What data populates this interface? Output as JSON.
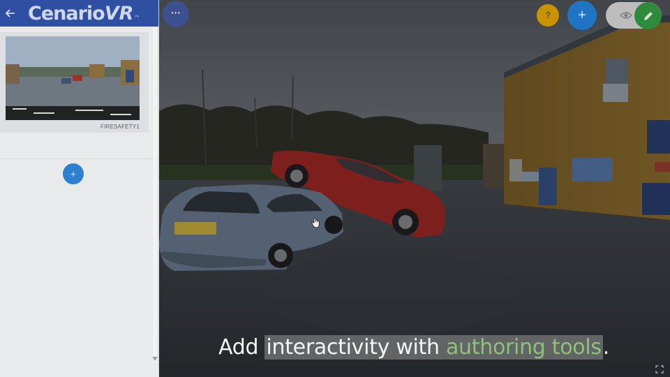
{
  "app": {
    "logo_main": "Cenario",
    "logo_vr": "VR",
    "logo_tm": "™"
  },
  "sidebar": {
    "back_icon": "back-arrow-icon",
    "scenes": [
      {
        "label": "FIRESAFETY1"
      }
    ],
    "add_scene_label": "+"
  },
  "toolbar": {
    "more_label": "···",
    "help_label": "?",
    "add_label": "+",
    "preview_icon": "eye-icon",
    "edit_icon": "pencil-icon"
  },
  "caption": {
    "part1": "Add ",
    "part2": "interactivity",
    "part3": " with ",
    "part4": "authoring tools",
    "part5": "."
  },
  "colors": {
    "header_blue": "#2f4fa3",
    "accent_blue": "#1f74c4",
    "help_yellow": "#c99300",
    "edit_green": "#2f8a3c",
    "caption_accent": "#8ec27c"
  }
}
